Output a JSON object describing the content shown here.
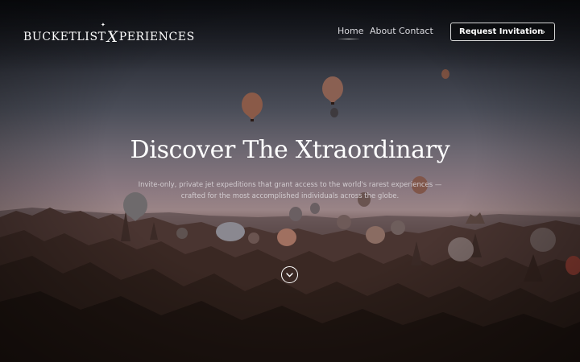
{
  "brand": {
    "logo_before": "BUCKETLIST",
    "logo_x": "X",
    "logo_after": "PERIENCES"
  },
  "nav": {
    "items": [
      {
        "label": "Home",
        "active": true
      },
      {
        "label": "About",
        "active": false
      },
      {
        "label": "Contact",
        "active": false
      }
    ]
  },
  "cta": {
    "label": "Request Invitation",
    "icon": "chevron-right-icon"
  },
  "hero": {
    "headline": "Discover The Xtraordinary",
    "subtext": "Invite-only, private jet expeditions that grant access to the world's rarest experiences — crafted for the most accomplished individuals across the globe.",
    "scroll_icon": "chevron-down-icon",
    "background": "hot-air-balloons-over-rock-valley-at-dusk"
  },
  "colors": {
    "text": "#ffffff",
    "nav_text": "#d9d9de",
    "subtext": "#d2ccd0",
    "button_border": "#d8d8d8"
  }
}
